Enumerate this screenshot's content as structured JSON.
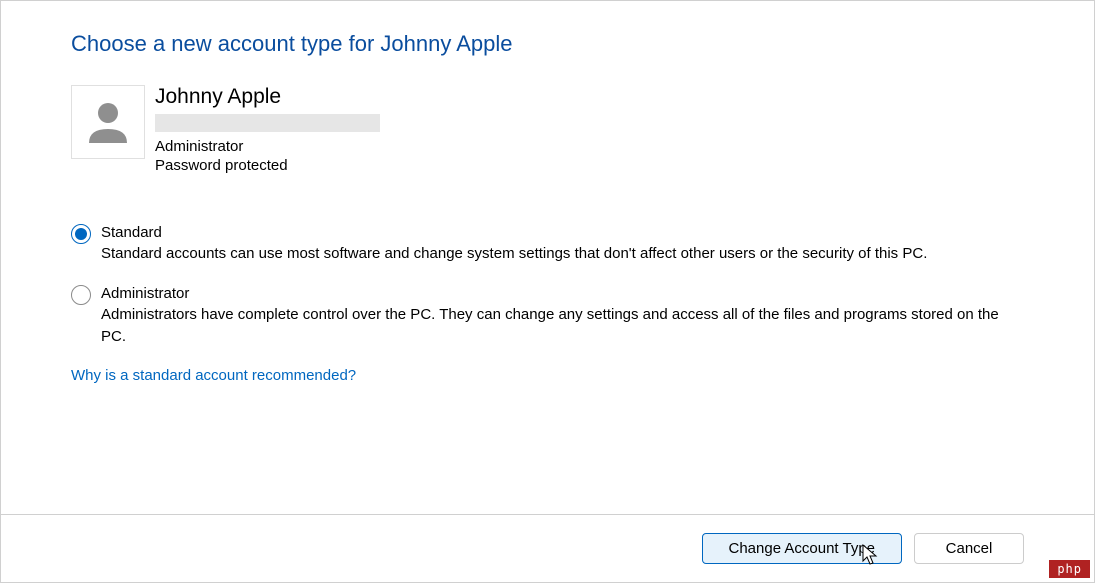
{
  "header": {
    "title": "Choose a new account type for Johnny Apple"
  },
  "user": {
    "name": "Johnny Apple",
    "role": "Administrator",
    "password_status": "Password protected"
  },
  "options": {
    "standard": {
      "label": "Standard",
      "description": "Standard accounts can use most software and change system settings that don't affect other users or the security of this PC.",
      "selected": true
    },
    "administrator": {
      "label": "Administrator",
      "description": "Administrators have complete control over the PC. They can change any settings and access all of the files and programs stored on the PC.",
      "selected": false
    }
  },
  "help_link": "Why is a standard account recommended?",
  "footer": {
    "primary_button": "Change Account Type",
    "secondary_button": "Cancel"
  },
  "watermark": "php"
}
